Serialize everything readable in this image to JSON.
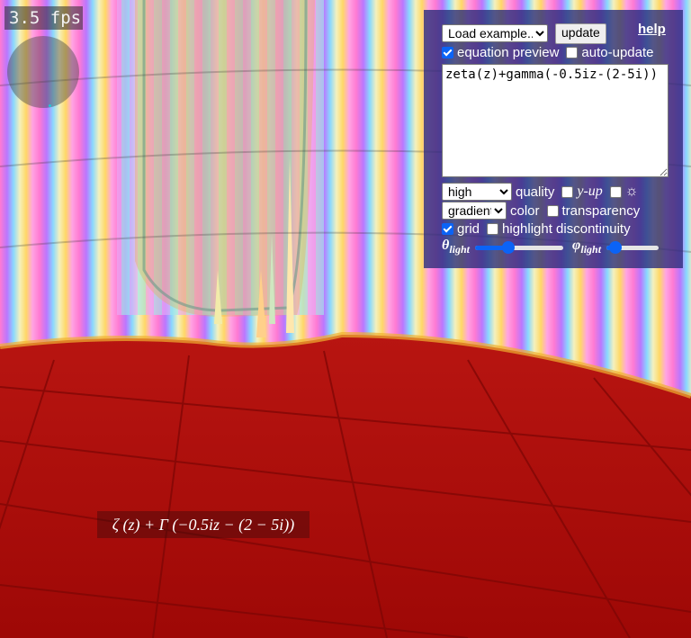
{
  "overlay": {
    "fps": "3.5 fps"
  },
  "panel": {
    "examples_select": "Load example...",
    "update_label": "update",
    "help_label": "help",
    "equation_preview": {
      "label": "equation preview",
      "checked": true
    },
    "auto_update": {
      "label": "auto-update",
      "checked": false
    },
    "equation_text": "zeta(z)+gamma(-0.5iz-(2-5i))",
    "quality_select": "high",
    "quality_label": "quality",
    "y_up": {
      "label": "y-up",
      "checked": false
    },
    "light_toggle": {
      "icon": "sun-icon",
      "checked": false
    },
    "color_select": "gradient",
    "color_label": "color",
    "transparency": {
      "label": "transparency",
      "checked": false
    },
    "grid": {
      "label": "grid",
      "checked": true
    },
    "highlight_discontinuity": {
      "label": "highlight discontinuity",
      "checked": false
    },
    "theta_light": {
      "symbol": "θ",
      "sub": "light",
      "value": 0.38
    },
    "phi_light": {
      "symbol": "φ",
      "sub": "light",
      "value": 0.18
    }
  },
  "equation_preview_text": "ζ (z) + Γ (−0.5iz − (2 − 5i))",
  "colors": {
    "floor": "#a40a08",
    "panel": "#2c2e7a",
    "accent": "#0b63f6"
  }
}
